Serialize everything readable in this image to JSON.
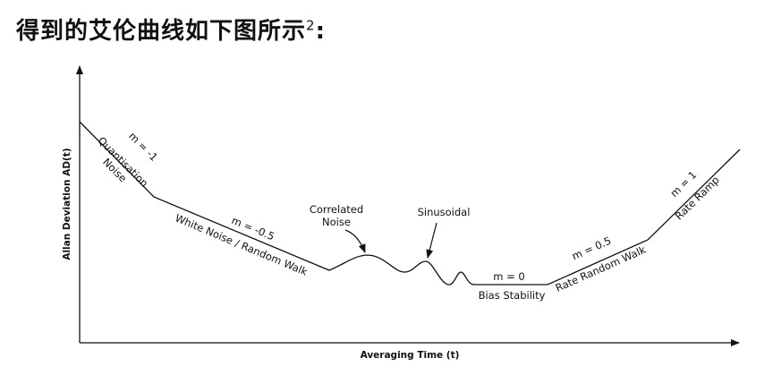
{
  "page": {
    "heading": "得到的艾伦曲线如下图所示",
    "heading_sup": "2",
    "heading_suffix": ":"
  },
  "diagram": {
    "y_axis_label": "Allan Deviation AD(t)",
    "x_axis_label": "Averaging Time (t)",
    "segments": {
      "quantisation": {
        "slope": "m = -1",
        "name_line1": "Quantisation",
        "name_line2": "Noise"
      },
      "white": {
        "slope": "m = -0.5",
        "name": "White Noise / Random Walk"
      },
      "correlated": {
        "name_line1": "Correlated",
        "name_line2": "Noise"
      },
      "sinusoidal": {
        "name": "Sinusoidal"
      },
      "bias": {
        "slope": "m = 0",
        "name": "Bias Stability"
      },
      "rate_rw": {
        "slope": "m = 0.5",
        "name": "Rate Random Walk"
      },
      "rate_ramp": {
        "slope": "m = 1",
        "name": "Rate Ramp"
      }
    },
    "colors": {
      "line": "#111111",
      "background": "#ffffff"
    }
  }
}
